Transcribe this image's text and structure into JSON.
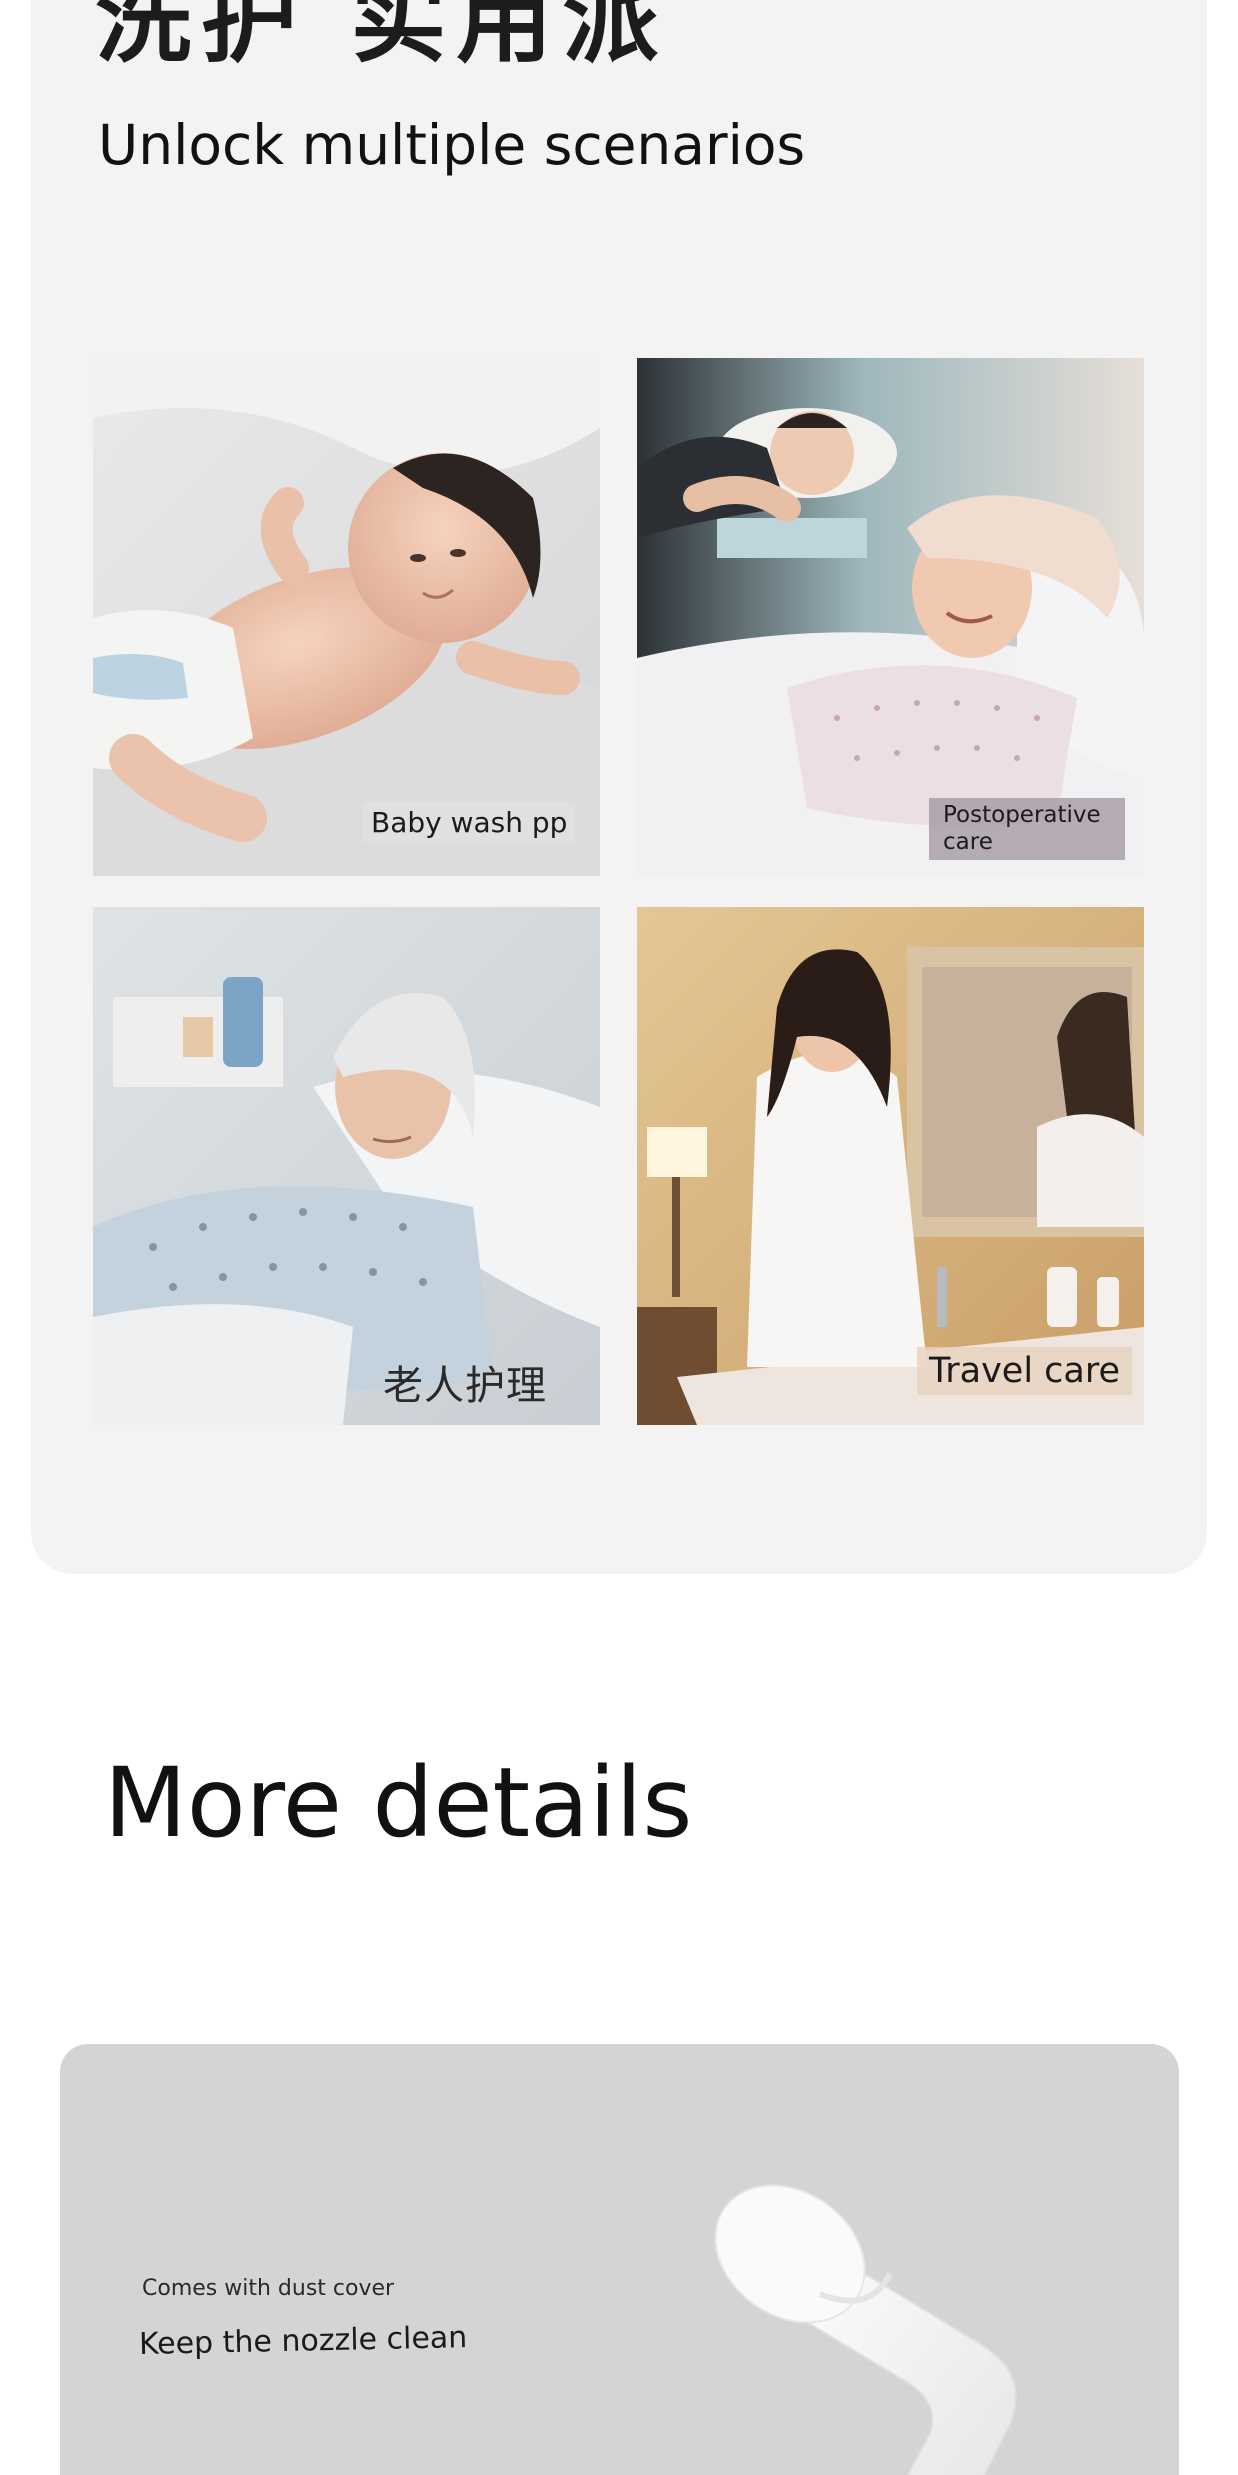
{
  "scenarios": {
    "heading_cn": "洗护 实用派",
    "subtitle": "Unlock multiple scenarios",
    "tiles": [
      {
        "caption": "Baby wash pp",
        "image": "baby-lying-on-bed"
      },
      {
        "caption": "Postoperative care",
        "image": "new-mother-in-hospital-bed"
      },
      {
        "caption": "老人护理",
        "image": "elderly-woman-in-hospital-bed"
      },
      {
        "caption": "Travel care",
        "image": "woman-in-robe-at-bathroom-sink"
      }
    ]
  },
  "details": {
    "title": "More details",
    "card": {
      "small_label": "Comes with dust cover",
      "headline": "Keep the nozzle clean",
      "image": "white-nozzle-with-dust-cover"
    }
  },
  "colors": {
    "card_background": "#f3f3f3",
    "detail_card_background": "#d4d4d4",
    "page_background": "#ffffff"
  }
}
